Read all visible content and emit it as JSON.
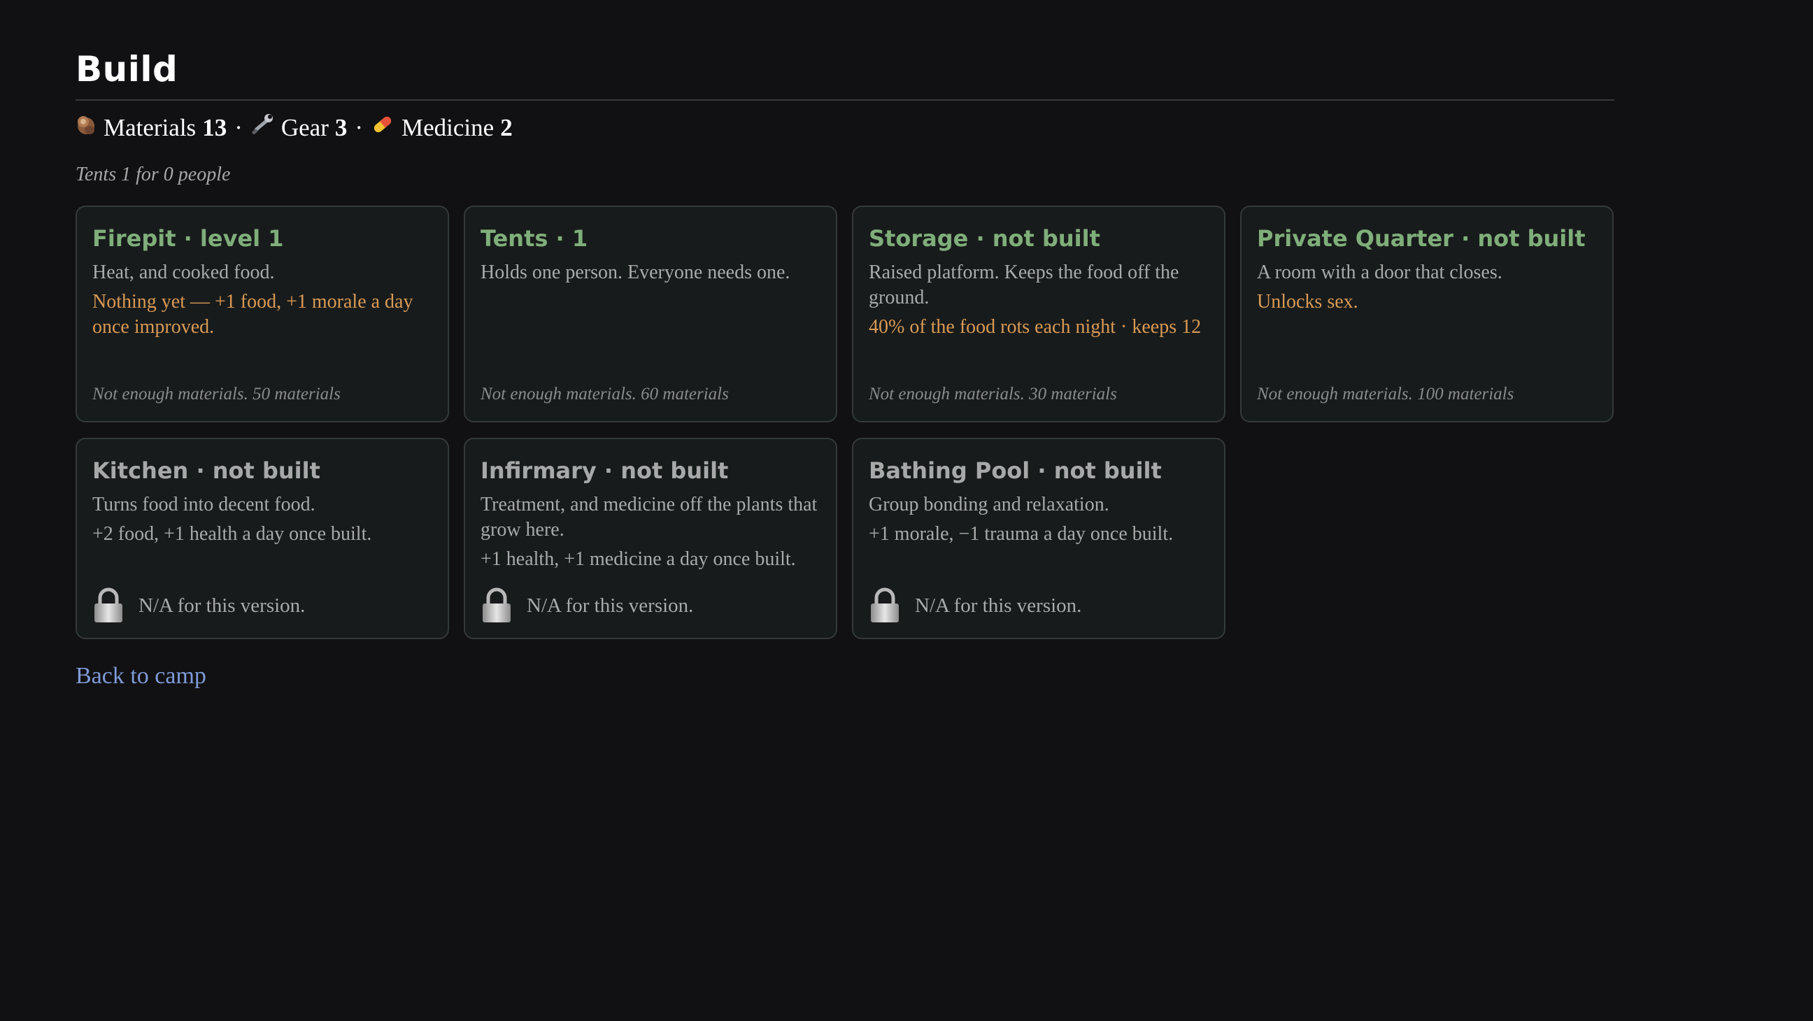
{
  "page": {
    "title": "Build"
  },
  "resources": [
    {
      "icon": "wood-log-icon",
      "label": "Materials",
      "value": "13"
    },
    {
      "icon": "wrench-icon",
      "label": "Gear",
      "value": "3"
    },
    {
      "icon": "pill-icon",
      "label": "Medicine",
      "value": "2"
    }
  ],
  "separator": "·",
  "tents_note": "Tents 1 for 0 people",
  "cards": [
    {
      "title": "Firepit · level 1",
      "description": "Heat, and cooked food.",
      "note": "Nothing yet — +1 food, +1 morale a day once improved.",
      "cost": "Not enough materials. 50 materials"
    },
    {
      "title": "Tents · 1",
      "description": "Holds one person. Everyone needs one.",
      "cost": "Not enough materials. 60 materials"
    },
    {
      "title": "Storage · not built",
      "description": "Raised platform. Keeps the food off the ground.",
      "note": "40% of the food rots each night · keeps 12",
      "cost": "Not enough materials. 30 materials"
    },
    {
      "title": "Private Quarter · not built",
      "description": "A room with a door that closes.",
      "note": "Unlocks sex.",
      "cost": "Not enough materials. 100 materials"
    },
    {
      "title": "Kitchen · not built",
      "description": "Turns food into decent food.",
      "effect": "+2 food, +1 health a day once built.",
      "locked_text": "N/A for this version."
    },
    {
      "title": "Infirmary · not built",
      "description": "Treatment, and medicine off the plants that grow here.",
      "effect": "+1 health, +1 medicine a day once built.",
      "locked_text": "N/A for this version."
    },
    {
      "title": "Bathing Pool · not built",
      "description": "Group bonding and relaxation.",
      "effect": "+1 morale, −1 trauma a day once built.",
      "locked_text": "N/A for this version."
    }
  ],
  "back_link": "Back to camp",
  "colors": {
    "background": "#111012",
    "title_available": "#7fae7a",
    "title_locked": "#a7a9a9",
    "warning": "#d99a55",
    "link": "#7f9bd8"
  }
}
